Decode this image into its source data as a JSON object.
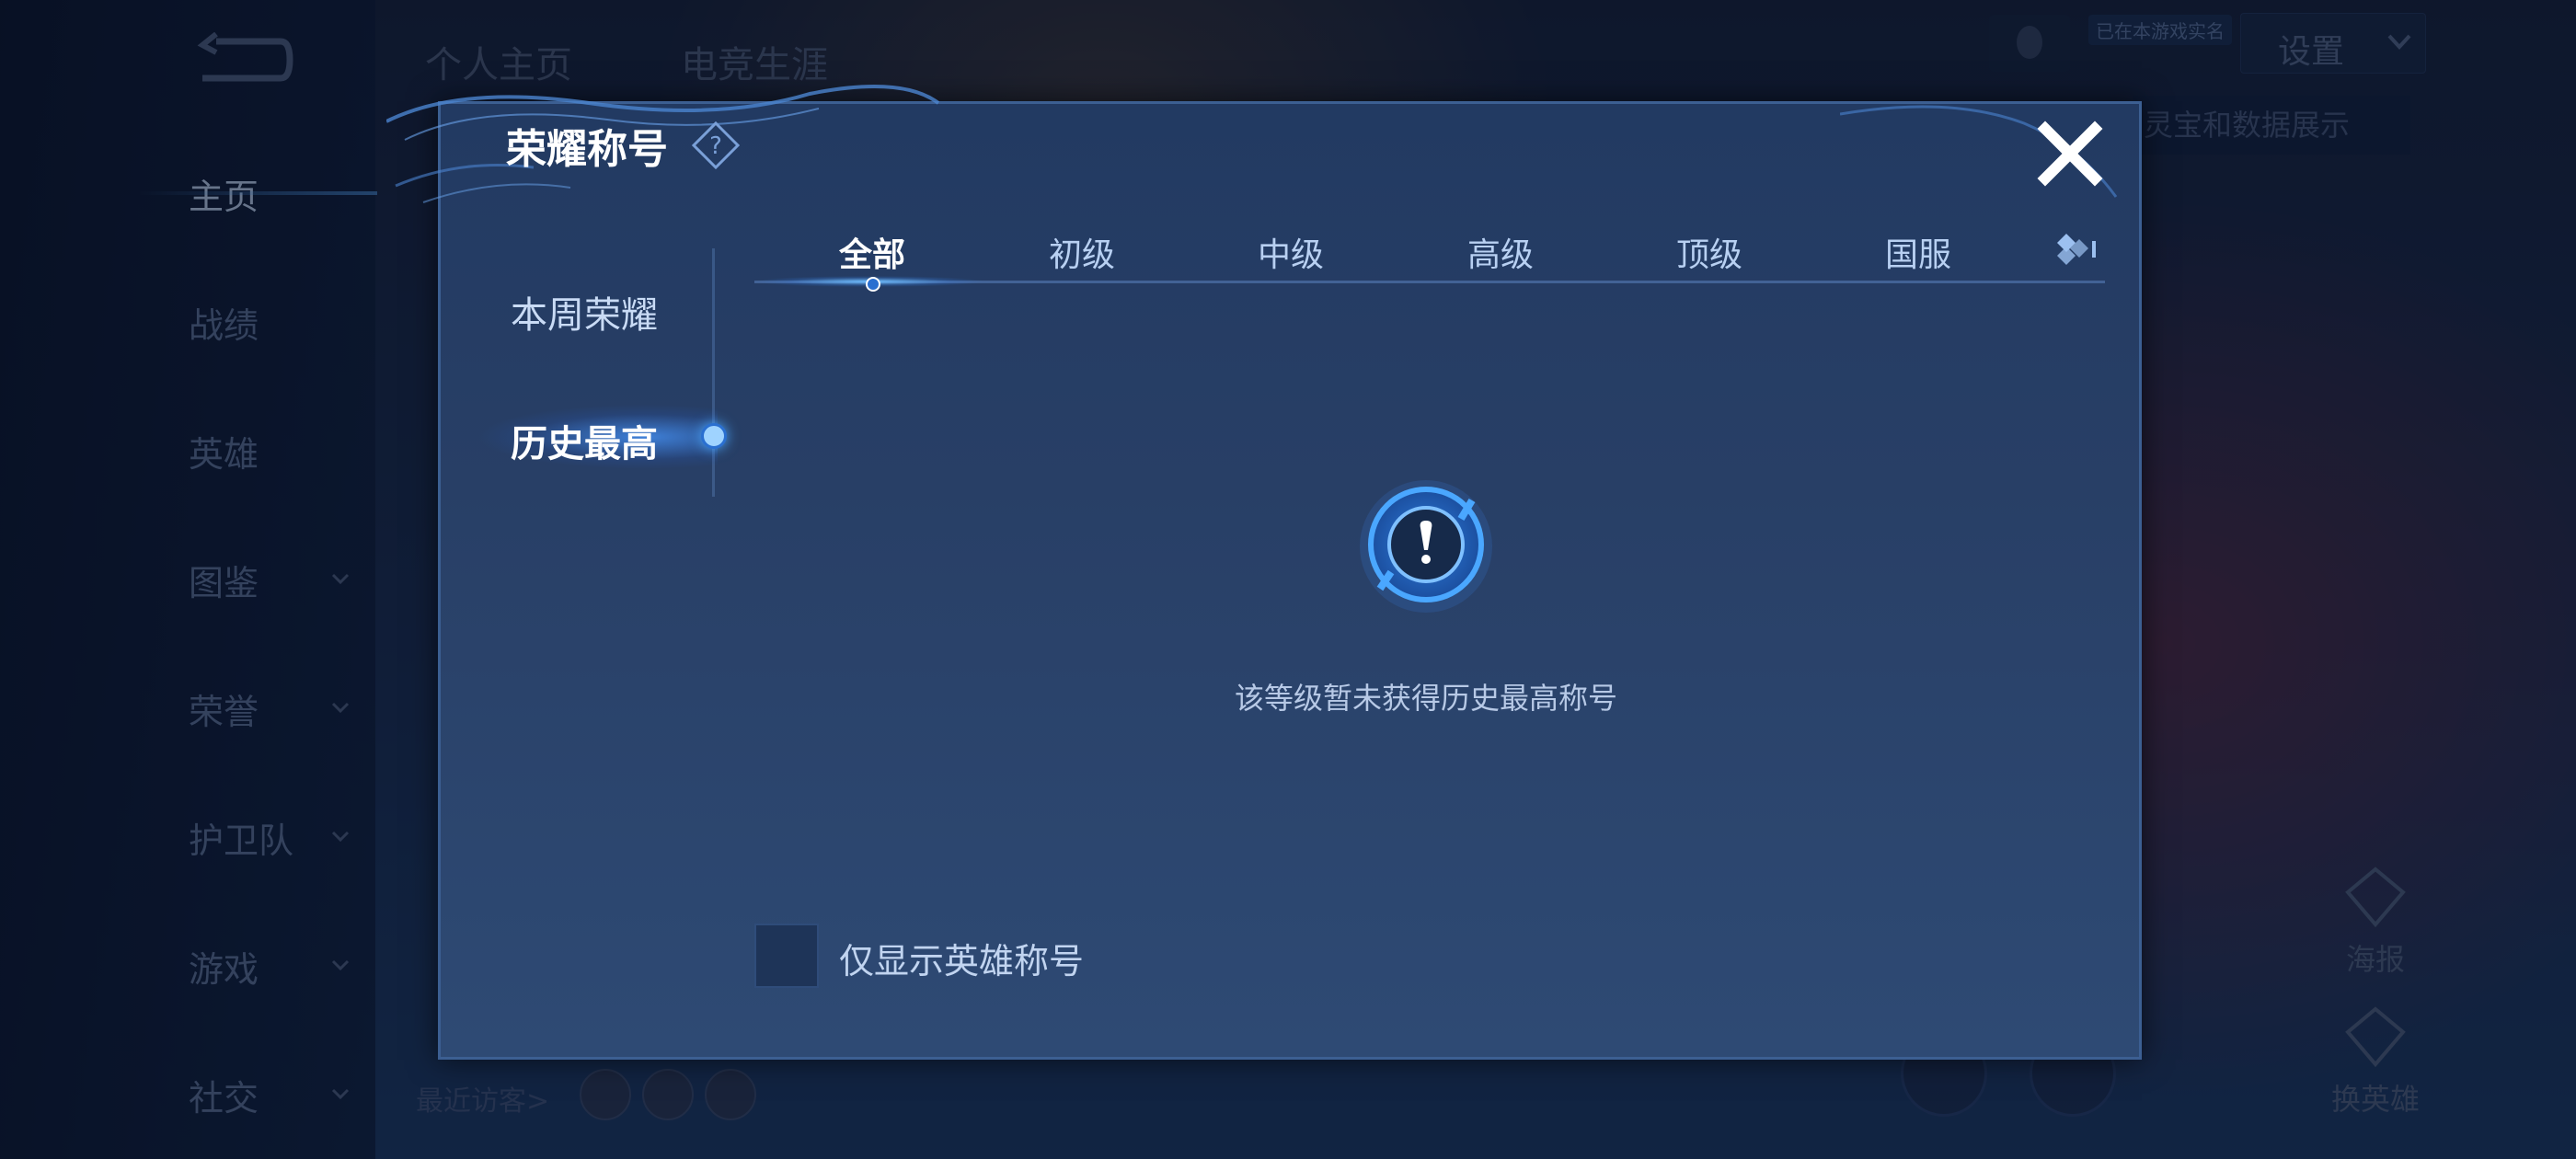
{
  "background": {
    "top_tabs": [
      "个人主页",
      "电竞生涯"
    ],
    "nav_items": [
      {
        "label": "主页",
        "active": true,
        "has_chevron": false
      },
      {
        "label": "战绩",
        "active": false,
        "has_chevron": false
      },
      {
        "label": "英雄",
        "active": false,
        "has_chevron": false
      },
      {
        "label": "图鉴",
        "active": false,
        "has_chevron": true
      },
      {
        "label": "荣誉",
        "active": false,
        "has_chevron": true
      },
      {
        "label": "护卫队",
        "active": false,
        "has_chevron": true
      },
      {
        "label": "游戏",
        "active": false,
        "has_chevron": true
      },
      {
        "label": "社交",
        "active": false,
        "has_chevron": true
      }
    ],
    "online_badge": "已在本游戏实名",
    "settings_label": "设置",
    "info_banner": "灵宝和数据展示",
    "side_buttons": [
      "海报",
      "换英雄"
    ],
    "recent_visitors_label": "最近访客>"
  },
  "modal": {
    "title": "荣耀称号",
    "side_tabs": [
      {
        "label": "本周荣耀",
        "active": false
      },
      {
        "label": "历史最高",
        "active": true
      }
    ],
    "tabs": [
      {
        "label": "全部",
        "active": true
      },
      {
        "label": "初级",
        "active": false
      },
      {
        "label": "中级",
        "active": false
      },
      {
        "label": "高级",
        "active": false
      },
      {
        "label": "顶级",
        "active": false
      },
      {
        "label": "国服",
        "active": false
      }
    ],
    "empty_message": "该等级暂未获得历史最高称号",
    "filter_label": "仅显示英雄称号",
    "filter_checked": false
  },
  "colors": {
    "accent": "#4aa7ff",
    "modal_bg": "#283f66",
    "text_primary": "#ffffff"
  }
}
